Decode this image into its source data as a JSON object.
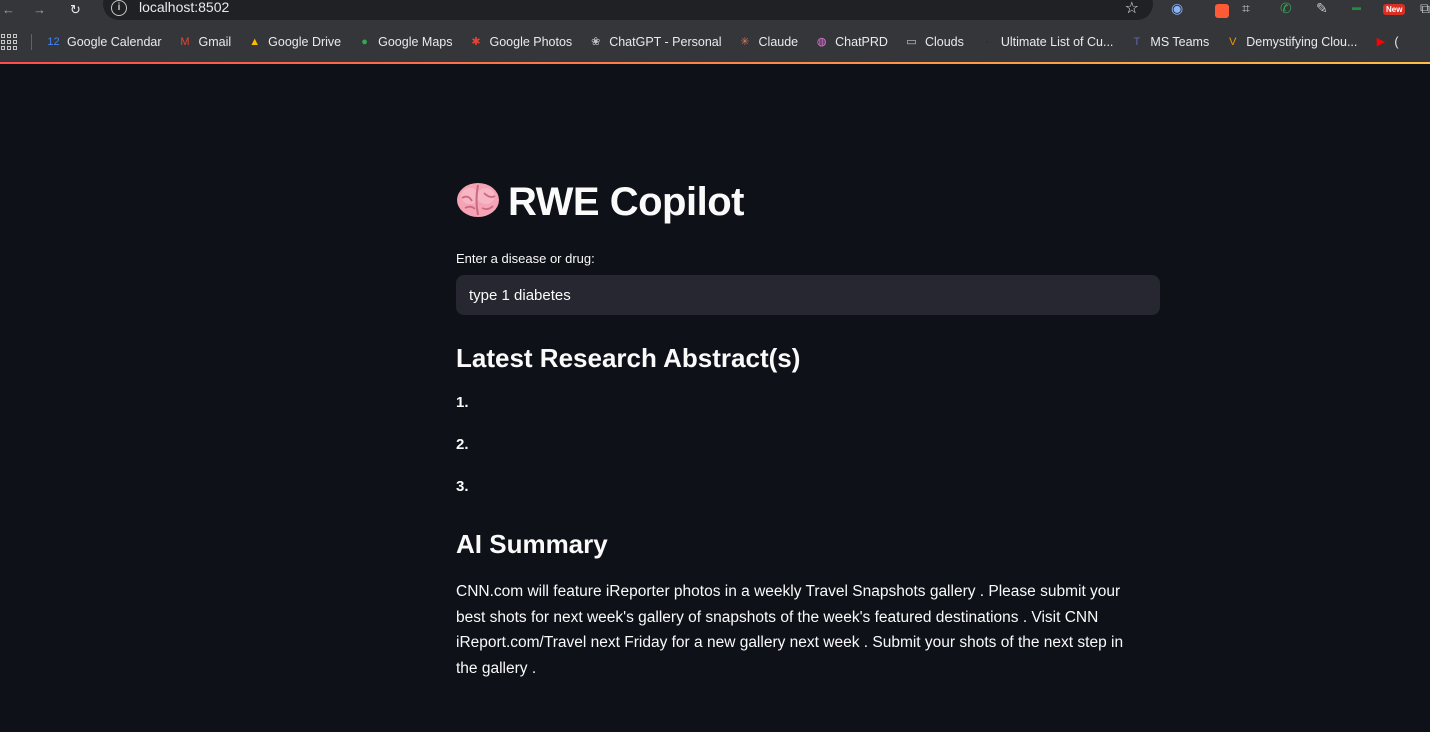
{
  "browser": {
    "url": "localhost:8502",
    "extensions": {
      "new_badge": "New"
    },
    "bookmarks": [
      {
        "label": "Google Calendar",
        "icon": "calendar-icon",
        "color": "#4285f4",
        "glyph": "12"
      },
      {
        "label": "Gmail",
        "icon": "gmail-icon",
        "color": "#ea4335",
        "glyph": "M"
      },
      {
        "label": "Google Drive",
        "icon": "drive-icon",
        "color": "#fbbc04",
        "glyph": "▲"
      },
      {
        "label": "Google Maps",
        "icon": "maps-icon",
        "color": "#34a853",
        "glyph": "●"
      },
      {
        "label": "Google Photos",
        "icon": "photos-icon",
        "color": "#ea4335",
        "glyph": "✱"
      },
      {
        "label": "ChatGPT - Personal",
        "icon": "chatgpt-icon",
        "color": "#c4c7c5",
        "glyph": "❀"
      },
      {
        "label": "Claude",
        "icon": "claude-icon",
        "color": "#d97757",
        "glyph": "✳"
      },
      {
        "label": "ChatPRD",
        "icon": "chatprd-icon",
        "color": "#e67ae0",
        "glyph": "◍"
      },
      {
        "label": "Clouds",
        "icon": "folder-icon",
        "color": "#c4c7c5",
        "glyph": "▭"
      },
      {
        "label": "Ultimate List of Cu...",
        "icon": "site-icon",
        "color": "#202124",
        "glyph": "·"
      },
      {
        "label": "MS Teams",
        "icon": "teams-icon",
        "color": "#6264a7",
        "glyph": "T"
      },
      {
        "label": "Demystifying Clou...",
        "icon": "v-icon",
        "color": "#f29900",
        "glyph": "V"
      },
      {
        "label": "(",
        "icon": "youtube-icon",
        "color": "#ff0000",
        "glyph": "▶"
      }
    ]
  },
  "app": {
    "title": "RWE Copilot",
    "input": {
      "label": "Enter a disease or drug:",
      "value": "type 1 diabetes"
    },
    "abstracts_heading": "Latest Research Abstract(s)",
    "abstracts": [
      {
        "num": "1."
      },
      {
        "num": "2."
      },
      {
        "num": "3."
      }
    ],
    "summary_heading": "AI Summary",
    "summary_text": "CNN.com will feature iReporter photos in a weekly Travel Snapshots gallery . Please submit your best shots for next week's gallery of snapshots of the week's featured destinations . Visit CNN iReport.com/Travel next Friday for a new gallery next week . Submit your shots of the next step in the gallery ."
  }
}
